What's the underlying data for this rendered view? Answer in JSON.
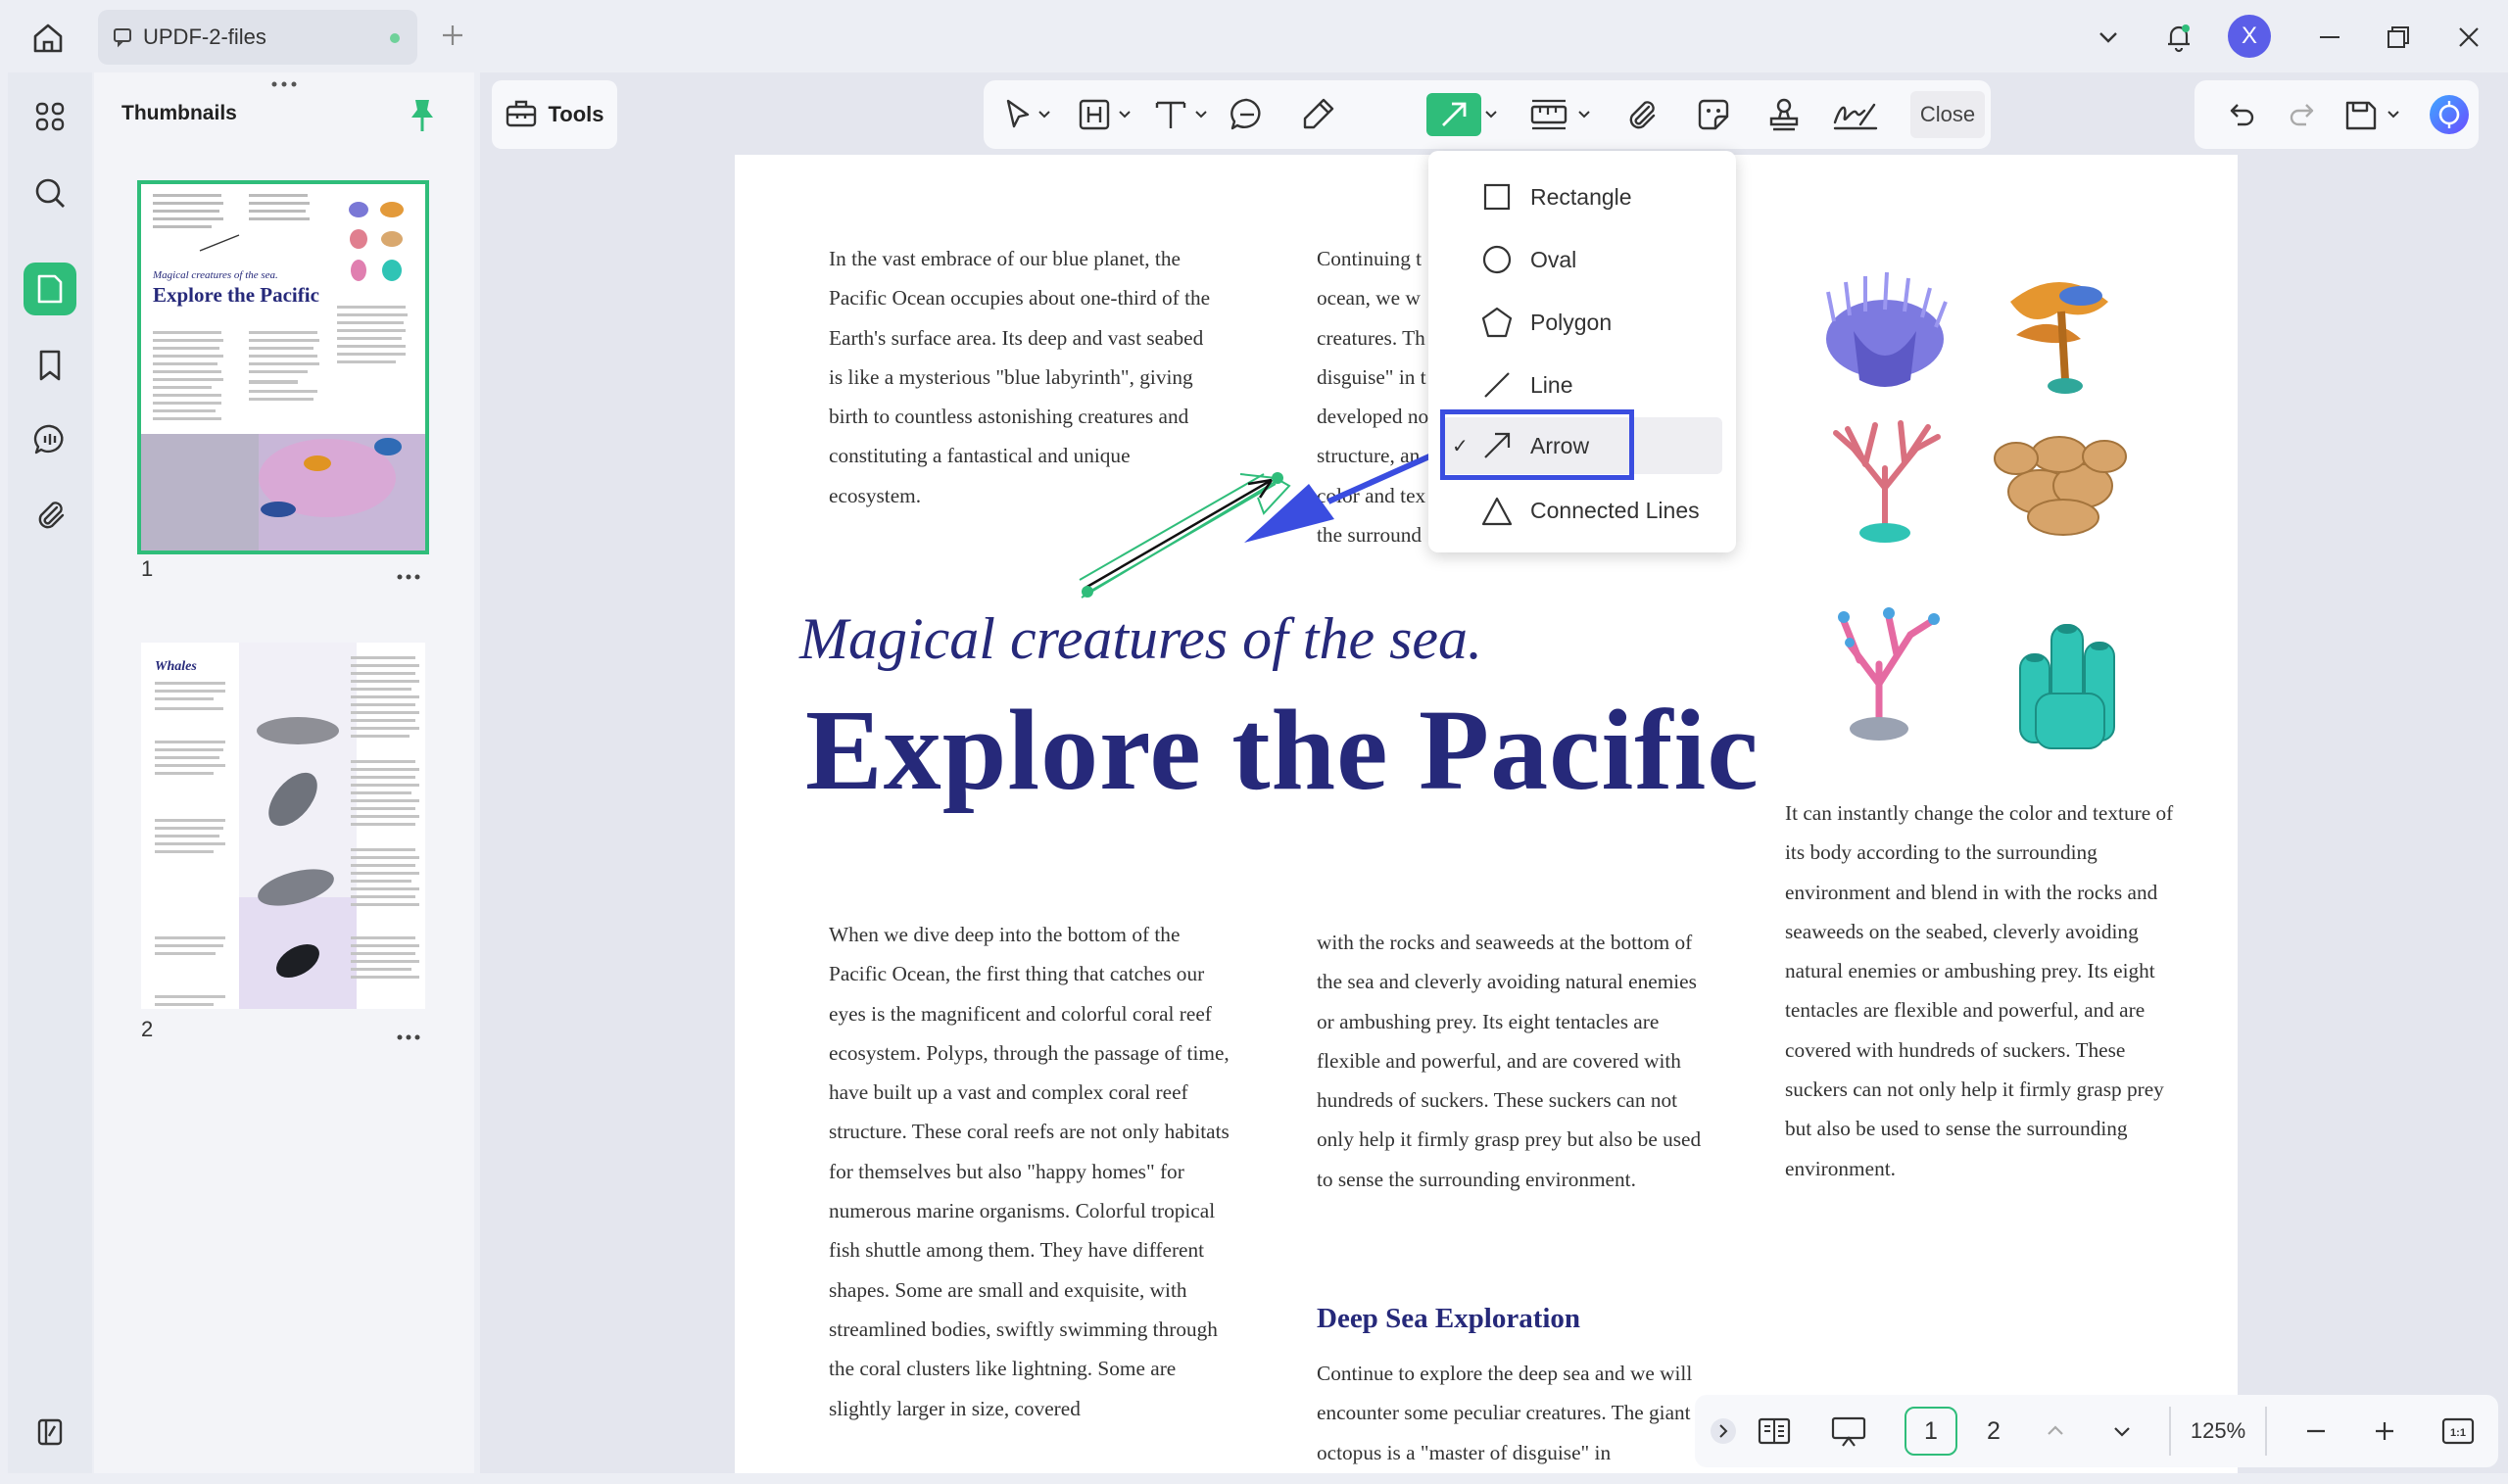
{
  "window": {
    "tab_title": "UPDF-2-files",
    "avatar_letter": "X",
    "icons": [
      "home-icon",
      "document-tab-icon",
      "add-tab-icon",
      "chevron-down-icon",
      "notification-bell-icon",
      "minimize-icon",
      "restore-icon",
      "close-window-icon"
    ]
  },
  "rail": {
    "items": [
      "grid-icon",
      "search-icon",
      "thumbnails-icon",
      "bookmark-icon",
      "comments-icon",
      "attachment-icon",
      "layers-icon"
    ],
    "active": "thumbnails-icon"
  },
  "thumbnails": {
    "title": "Thumbnails",
    "pages": [
      {
        "number": "1",
        "heading": "Explore the Pacific",
        "subheading": "Magical creatures of the sea."
      },
      {
        "number": "2",
        "heading": "Whales"
      }
    ]
  },
  "toolbar": {
    "tools_label": "Tools",
    "close_label": "Close",
    "tools": [
      "select-tool-icon",
      "text-box-tool-icon",
      "text-tool-icon",
      "comment-tool-icon",
      "highlighter-tool-icon",
      "shape-arrow-tool-icon",
      "measure-tool-icon",
      "attach-tool-icon",
      "sticker-tool-icon",
      "stamp-tool-icon",
      "signature-tool-icon"
    ],
    "active_tool": "shape-arrow-tool-icon",
    "colors": {
      "accent": "#2fbd7a",
      "highlight": "#3a4de0"
    }
  },
  "shape_menu": {
    "items": [
      {
        "label": "Rectangle",
        "icon": "rectangle-icon"
      },
      {
        "label": "Oval",
        "icon": "oval-icon"
      },
      {
        "label": "Polygon",
        "icon": "polygon-icon"
      },
      {
        "label": "Line",
        "icon": "line-icon"
      },
      {
        "label": "Arrow",
        "icon": "arrow-icon"
      },
      {
        "label": "Connected Lines",
        "icon": "connected-lines-icon"
      }
    ],
    "selected": "Arrow",
    "check": "✓"
  },
  "document": {
    "intro_col1": "In the vast embrace of our blue planet, the Pacific Ocean occupies about one-third of the Earth's surface area. Its deep and vast seabed is like a mysterious \"blue labyrinth\", giving birth to countless astonishing creatures and constituting a fantastical and unique ecosystem.",
    "intro_col2": "Continuing t ocean, we w creatures. Th disguise\" in t developed no structure, an color and tex the surround",
    "subtitle": "Magical creatures of the sea.",
    "headline": "Explore the Pacific",
    "body_col1": "When we dive deep into the bottom of the Pacific Ocean, the first thing that catches our eyes is the magnificent and colorful coral reef ecosystem. Polyps, through the passage of time, have built up a vast and complex coral reef structure. These coral reefs are not only habitats for themselves but also \"happy homes\" for numerous marine organisms. Colorful tropical fish shuttle among them. They have different shapes. Some are small and exquisite, with streamlined bodies, swiftly swimming through the coral clusters like lightning. Some are slightly larger in size, covered",
    "body_col2": "with the rocks and seaweeds at the bottom of the sea and cleverly avoiding natural enemies or ambushing prey. Its eight tentacles are flexible and powerful, and are covered with hundreds of suckers. These suckers can not only help it firmly grasp prey but also be used to sense the surrounding environment.",
    "section_heading": "Deep Sea Exploration",
    "section_text": "Continue to explore the deep sea and we will encounter some peculiar creatures. The giant octopus is a \"master of disguise\" in",
    "body_col3": "It can instantly change the color and texture of its body according to the surrounding environment and blend in with the rocks and seaweeds on the seabed, cleverly avoiding natural enemies or ambushing prey. Its eight tentacles are flexible and powerful, and are covered with hundreds of suckers. These suckers can not only help it firmly grasp prey but also be used to sense the surrounding environment."
  },
  "pagebar": {
    "pages": [
      "1",
      "2"
    ],
    "current_page": "1",
    "zoom": "125%",
    "fit_label": "1:1"
  }
}
